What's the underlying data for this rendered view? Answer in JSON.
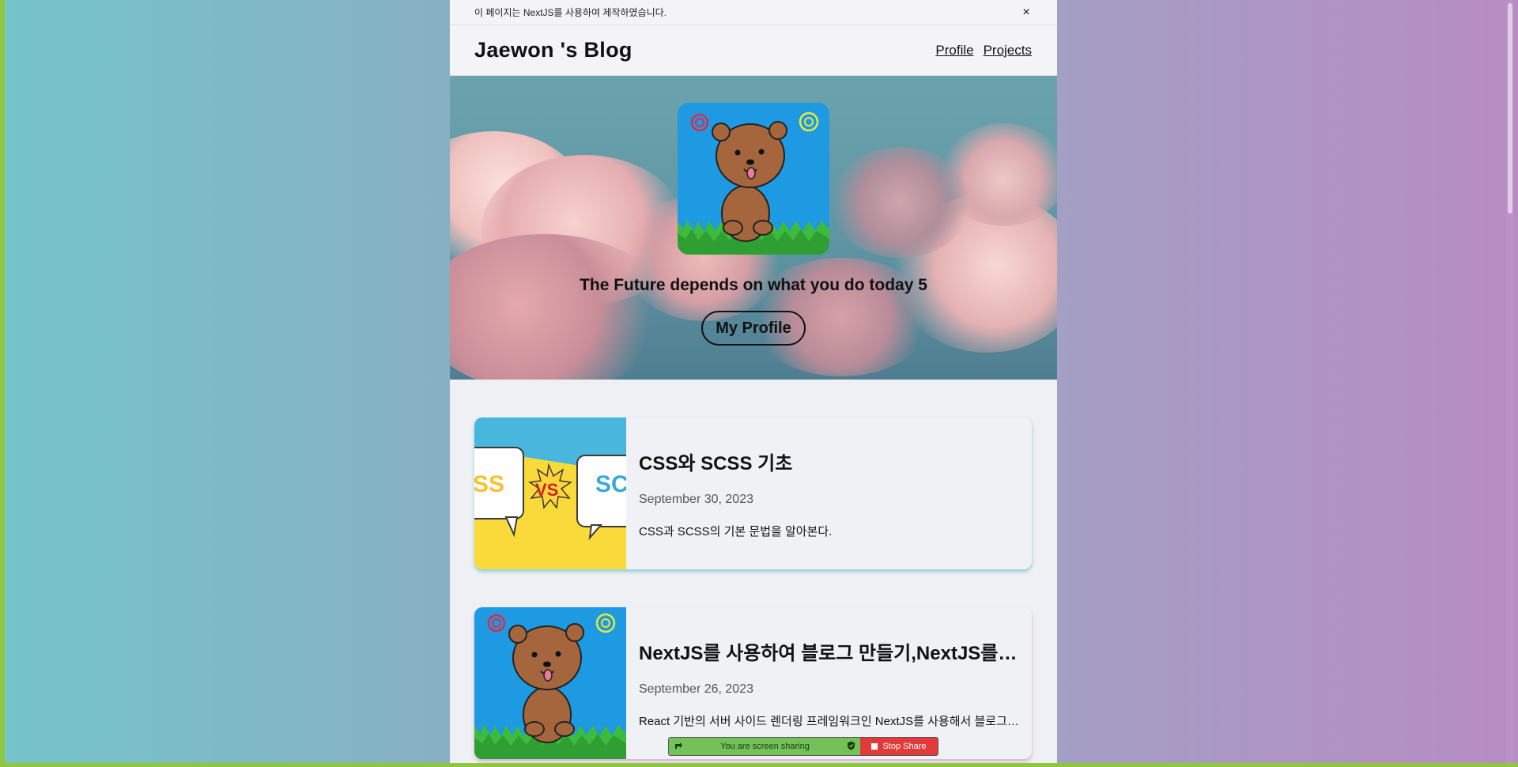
{
  "notice": {
    "text": "이 페이지는 NextJS를 사용하여 제작하였습니다.",
    "close_glyph": "×"
  },
  "header": {
    "title": "Jaewon 's Blog",
    "nav": [
      "Profile",
      "Projects"
    ]
  },
  "hero": {
    "tagline": "The Future depends on what you do today 5",
    "button_label": "My Profile"
  },
  "thumb1": {
    "left": "SS",
    "center": "VS",
    "right": "SC"
  },
  "posts": [
    {
      "title": "CSS와 SCSS 기초",
      "date": "September 30, 2023",
      "description": "CSS과 SCSS의 기본 문법을 알아본다."
    },
    {
      "title": "NextJS를 사용하여 블로그 만들기,NextJS를 사용하여 블로그 만들기",
      "date": "September 26, 2023",
      "description": "React 기반의 서버 사이드 렌더링 프레임워크인 NextJS를 사용해서 블로그를 만들어본다."
    }
  ],
  "share_bar": {
    "status_text": "You are screen sharing",
    "stop_label": "Stop Share"
  },
  "colors": {
    "avatar_bg": "#1d9ae2",
    "share_green": "#74c15a",
    "share_red": "#e23a3a",
    "frame_green": "#8fc73c"
  },
  "icons": [
    "close-icon",
    "bear-illustration",
    "share-icon",
    "shield-icon",
    "stop-icon"
  ]
}
